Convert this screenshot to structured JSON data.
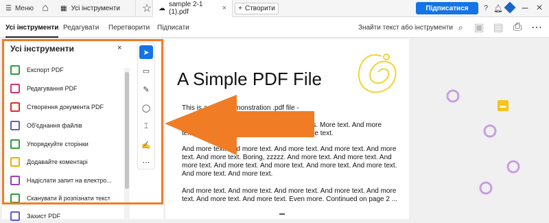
{
  "topbar": {
    "menu_label": "Меню",
    "tabs": [
      {
        "label": "Усі інструменти"
      },
      {
        "label": "sample 2-1 (1).pdf"
      }
    ],
    "create_label": "Створити",
    "subscribe_label": "Підписатися"
  },
  "menubar": {
    "items": [
      "Усі інструменти",
      "Редагувати",
      "Перетворити",
      "Підписати"
    ],
    "search_label": "Знайти текст або інструменти"
  },
  "panel": {
    "title": "Усі інструменти",
    "tools": [
      {
        "label": "Експорт PDF",
        "color": "#2e9c3e"
      },
      {
        "label": "Редагування PDF",
        "color": "#d4317b"
      },
      {
        "label": "Створення документа PDF",
        "color": "#d93025"
      },
      {
        "label": "Об'єднання файлів",
        "color": "#5b5fc7"
      },
      {
        "label": "Упорядкуйте сторінки",
        "color": "#2e9c3e"
      },
      {
        "label": "Додавайте коментарі",
        "color": "#e8b100"
      },
      {
        "label": "Надіслати запит на електро...",
        "color": "#9c3fb3"
      },
      {
        "label": "Сканувати й розпізнати текст",
        "color": "#2e9c3e"
      },
      {
        "label": "Захист PDF",
        "color": "#5b5fc7"
      }
    ]
  },
  "document": {
    "title": "A Simple PDF File",
    "lines": [
      "This is a small demonstration .pdf file -",
      "just for use in the Virtual Mechanics tutorials. More text. And more",
      "text. And more text. And more text. And more text.",
      "And more text. And more text. And more text. And more text. And more",
      "text. And more text. Boring, zzzzz. And more text. And more text. And",
      "more text. And more text. And more text. And more text. And more text.",
      "And more text. And more text.",
      "And more text. And more text. And more text. And more text. And more",
      "text. And more text. And more text. Even more. Continued on page 2 ..."
    ]
  },
  "accent_colors": {
    "annotation": "#f07c26",
    "primary": "#1473e6"
  }
}
